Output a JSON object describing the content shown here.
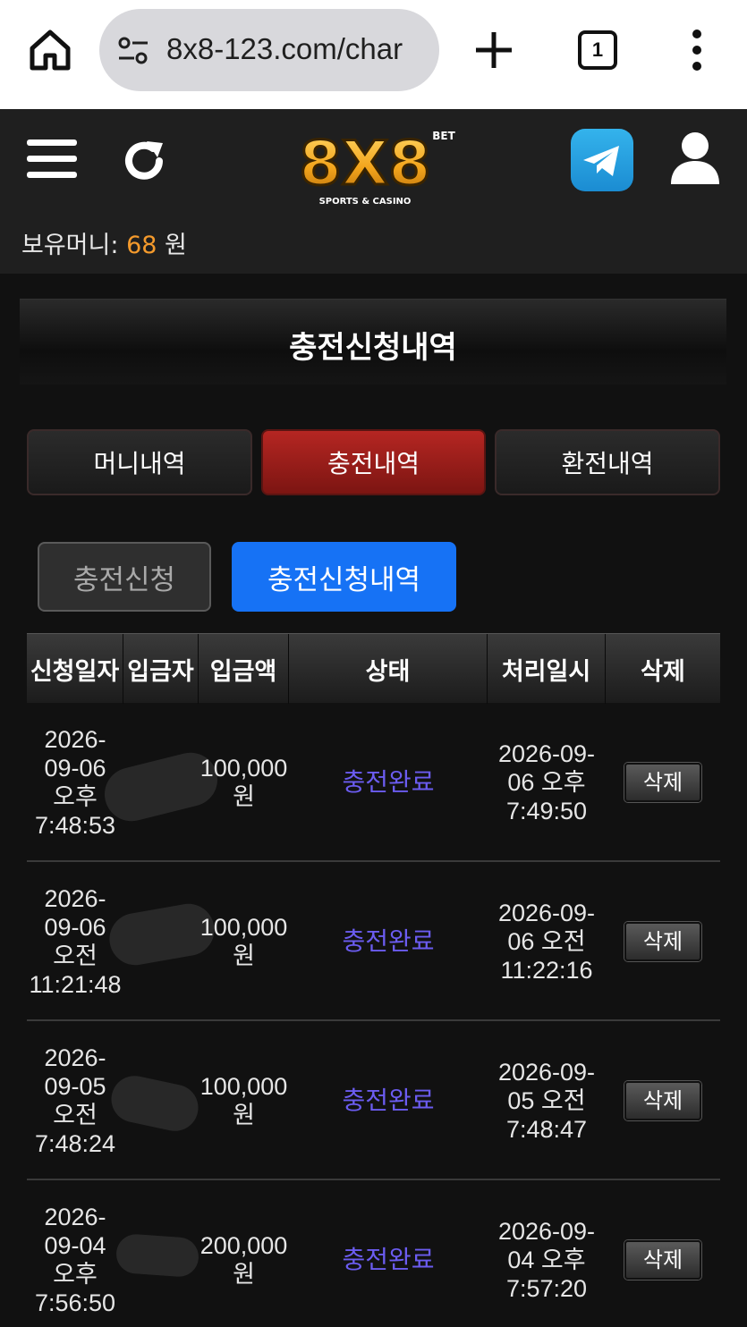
{
  "browser": {
    "url": "8x8-123.com/char",
    "tab_count": "1"
  },
  "header": {
    "logo_main": "8X8",
    "logo_badge": "BET",
    "logo_tagline": "SPORTS & CASINO",
    "balance_label": "보유머니:",
    "balance_amount": "68",
    "balance_unit": "원"
  },
  "page_title": "충전신청내역",
  "main_tabs": [
    {
      "label": "머니내역"
    },
    {
      "label": "충전내역"
    },
    {
      "label": "환전내역"
    }
  ],
  "sub_tabs": [
    {
      "label": "충전신청"
    },
    {
      "label": "충전신청내역"
    }
  ],
  "table": {
    "headers": [
      "신청일자",
      "입금자",
      "입금액",
      "상태",
      "처리일시",
      "삭제"
    ],
    "rows": [
      {
        "date_lines": [
          "2026-",
          "09-06",
          "오후",
          "7:48:53"
        ],
        "amount_lines": [
          "100,000",
          "원"
        ],
        "status": "충전완료",
        "processed_lines": [
          "2026-09-",
          "06 오후",
          "7:49:50"
        ],
        "delete_label": "삭제"
      },
      {
        "date_lines": [
          "2026-",
          "09-06",
          "오전",
          "11:21:48"
        ],
        "amount_lines": [
          "100,000",
          "원"
        ],
        "status": "충전완료",
        "processed_lines": [
          "2026-09-",
          "06 오전",
          "11:22:16"
        ],
        "delete_label": "삭제"
      },
      {
        "date_lines": [
          "2026-",
          "09-05",
          "오전",
          "7:48:24"
        ],
        "amount_lines": [
          "100,000",
          "원"
        ],
        "status": "충전완료",
        "processed_lines": [
          "2026-09-",
          "05 오전",
          "7:48:47"
        ],
        "delete_label": "삭제"
      },
      {
        "date_lines": [
          "2026-",
          "09-04",
          "오후",
          "7:56:50"
        ],
        "amount_lines": [
          "200,000",
          "원"
        ],
        "status": "충전완료",
        "processed_lines": [
          "2026-09-",
          "04 오후",
          "7:57:20"
        ],
        "delete_label": "삭제"
      }
    ]
  },
  "colors": {
    "accent_red": "#b52622",
    "accent_blue": "#1672f5",
    "balance_orange": "#f49a2c",
    "status_purple": "#6b5cf0"
  },
  "icons": {
    "home": "home-icon",
    "site_info": "tune-icon",
    "new_tab": "plus-icon",
    "menu": "more-vert-icon",
    "hamburger": "hamburger-icon",
    "refresh": "refresh-icon",
    "telegram": "telegram-icon",
    "user": "user-icon"
  }
}
